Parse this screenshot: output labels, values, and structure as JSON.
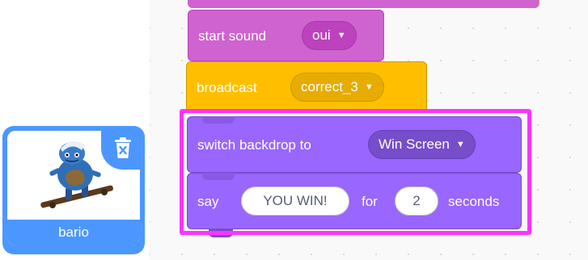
{
  "sprite": {
    "name": "bario",
    "delete_icon": "trash-icon"
  },
  "blocks": {
    "start_sound": {
      "label": "start sound",
      "value": "oui"
    },
    "broadcast": {
      "label": "broadcast",
      "value": "correct_3"
    },
    "switch_backdrop": {
      "label": "switch backdrop to",
      "value": "Win Screen"
    },
    "say": {
      "label_say": "say",
      "message": "YOU WIN!",
      "label_for": "for",
      "duration": "2",
      "label_seconds": "seconds"
    }
  },
  "colors": {
    "sound": "#cf63cf",
    "events": "#ffbf00",
    "looks": "#9966ff",
    "sprite_selected": "#4c97ff",
    "highlight": "#ff33ff"
  }
}
